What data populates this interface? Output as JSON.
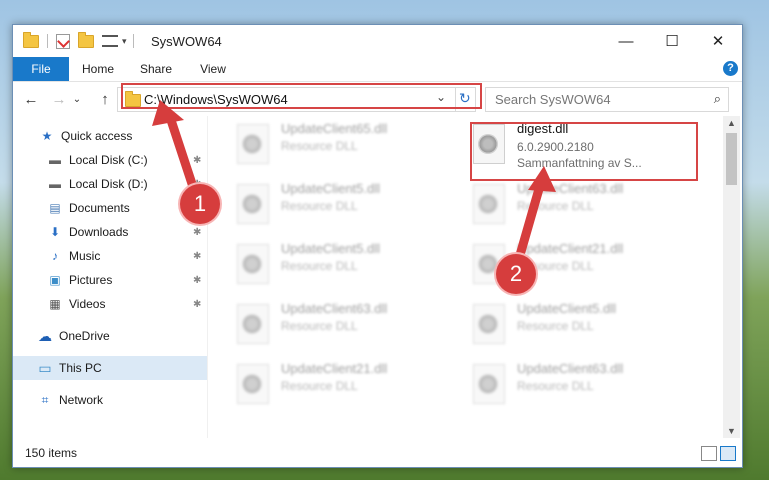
{
  "window": {
    "title": "SysWOW64",
    "controls": {
      "minimize": "—",
      "maximize": "☐",
      "close": "✕"
    }
  },
  "ribbon": {
    "tabs": [
      "File",
      "Home",
      "Share",
      "View"
    ],
    "help": "?"
  },
  "nav": {
    "back": "←",
    "forward": "→",
    "dropdown": "⌄",
    "up": "↑",
    "address": "C:\\Windows\\SysWOW64",
    "address_dropdown": "⌄",
    "refresh": "↻",
    "search_placeholder": "Search SysWOW64",
    "search_icon": "⌕"
  },
  "sidebar": {
    "items": [
      {
        "label": "Quick access",
        "icon": "★",
        "icon_name": "star-icon",
        "pinned": false
      },
      {
        "label": "Local Disk (C:)",
        "icon": "▬",
        "icon_name": "drive-icon",
        "pinned": true
      },
      {
        "label": "Local Disk (D:)",
        "icon": "▬",
        "icon_name": "drive-icon",
        "pinned": true
      },
      {
        "label": "Documents",
        "icon": "▤",
        "icon_name": "documents-icon",
        "pinned": true
      },
      {
        "label": "Downloads",
        "icon": "⬇",
        "icon_name": "download-icon",
        "pinned": true
      },
      {
        "label": "Music",
        "icon": "♪",
        "icon_name": "music-icon",
        "pinned": true
      },
      {
        "label": "Pictures",
        "icon": "▣",
        "icon_name": "pictures-icon",
        "pinned": true
      },
      {
        "label": "Videos",
        "icon": "▦",
        "icon_name": "videos-icon",
        "pinned": true
      },
      {
        "label": "OneDrive",
        "icon": "☁",
        "icon_name": "cloud-icon",
        "pinned": false
      },
      {
        "label": "This PC",
        "icon": "▭",
        "icon_name": "computer-icon",
        "pinned": false,
        "selected": true
      },
      {
        "label": "Network",
        "icon": "⌗",
        "icon_name": "network-icon",
        "pinned": false
      }
    ],
    "pin_glyph": "📌"
  },
  "files": {
    "left_column": [
      {
        "name": "UpdateClient65.dll",
        "type": "Resource DLL"
      },
      {
        "name": "UpdateClient5.dll",
        "type": "Resource DLL"
      },
      {
        "name": "UpdateClient5.dll",
        "type": "Resource DLL"
      },
      {
        "name": "UpdateClient63.dll",
        "type": "Resource DLL"
      },
      {
        "name": "UpdateClient21.dll",
        "type": "Resource DLL"
      }
    ],
    "right_column": [
      {
        "name": "digest.dll",
        "version": "6.0.2900.2180",
        "description": "Sammanfattning av S..."
      },
      {
        "name": "UpdateClient63.dll",
        "type": "Resource DLL"
      },
      {
        "name": "UpdateClient21.dll",
        "type": "Resource DLL"
      },
      {
        "name": "UpdateClient5.dll",
        "type": "Resource DLL"
      },
      {
        "name": "UpdateClient63.dll",
        "type": "Resource DLL"
      }
    ]
  },
  "status": {
    "item_count": "150 items"
  },
  "annotations": {
    "badge1": "1",
    "badge2": "2",
    "color": "#d63d3d"
  }
}
